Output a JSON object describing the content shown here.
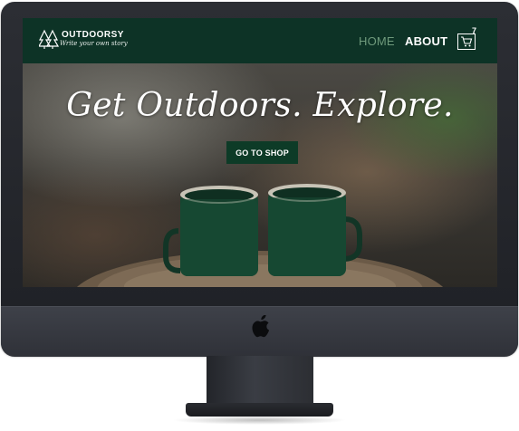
{
  "nav": {
    "brand_name": "OUTDOORSY",
    "brand_tagline": "Write your own story",
    "links": [
      "HOME",
      "ABOUT"
    ],
    "cart_count": "7"
  },
  "hero": {
    "title": "Get Outdoors. Explore.",
    "cta_label": "GO TO SHOP"
  },
  "icons": [
    "trees-logo-icon",
    "shopping-cart-icon",
    "apple-logo-icon"
  ],
  "colors": {
    "nav_background": "#0d3326",
    "nav_active_link": "#6f9a7c",
    "button_background": "#0d3b27",
    "monitor_bezel": "#2c2e34"
  }
}
